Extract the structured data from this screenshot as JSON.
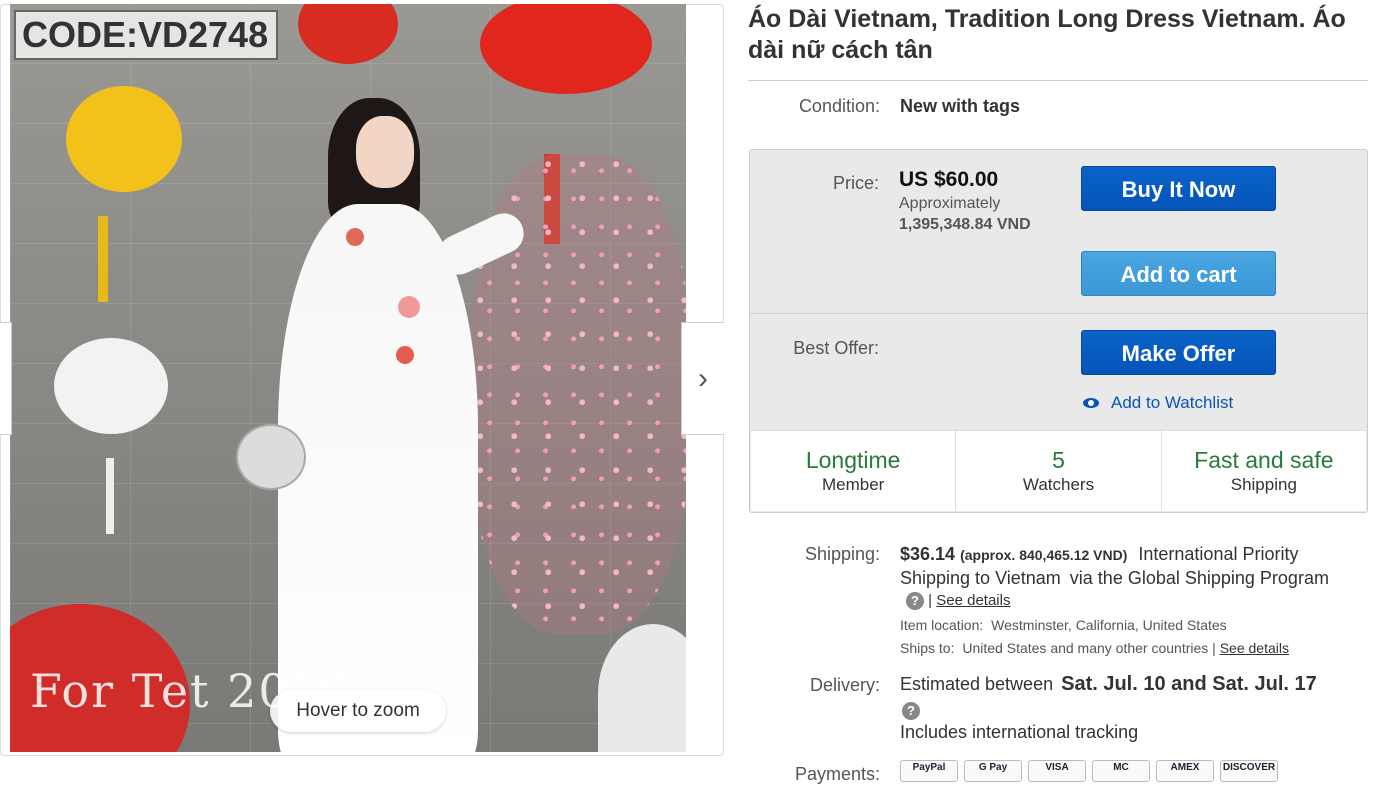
{
  "image": {
    "code_label": "CODE:VD2748",
    "watermark": "For Tet 2019",
    "zoom_hint": "Hover to zoom",
    "next_arrow": "›"
  },
  "listing": {
    "title": "Áo Dài Vietnam, Tradition Long Dress Vietnam. Áo dài nữ cách tân",
    "condition_label": "Condition:",
    "condition_value": "New with tags"
  },
  "buybox": {
    "price_label": "Price:",
    "price_value": "US $60.00",
    "approx_label": "Approximately",
    "approx_value": "1,395,348.84 VND",
    "buy_now": "Buy It Now",
    "add_to_cart": "Add to cart",
    "best_offer_label": "Best Offer:",
    "make_offer": "Make Offer",
    "watchlist": "Add to Watchlist"
  },
  "stats": [
    {
      "top": "Longtime",
      "bottom": "Member"
    },
    {
      "top": "5",
      "bottom": "Watchers"
    },
    {
      "top": "Fast and safe",
      "bottom": "Shipping"
    }
  ],
  "shipping": {
    "label": "Shipping:",
    "cost": "$36.14",
    "approx": "(approx. 840,465.12 VND)",
    "service": "International Priority Shipping to Vietnam",
    "program": "via the Global Shipping Program",
    "see_details": "See details",
    "location_label": "Item location:",
    "location_value": "Westminster, California, United States",
    "ships_to_label": "Ships to:",
    "ships_to_value": "United States and many other countries |",
    "ships_to_link": "See details"
  },
  "delivery": {
    "label": "Delivery:",
    "estimated": "Estimated between",
    "dates": "Sat. Jul. 10 and Sat. Jul. 17",
    "tracking": "Includes international tracking"
  },
  "payments": {
    "label": "Payments:",
    "methods": [
      "PayPal",
      "G Pay",
      "VISA",
      "MC",
      "AMEX",
      "DISCOVER"
    ]
  },
  "colors": {
    "primary_button": "#0654ba",
    "secondary_button": "#3b97d6",
    "stat_green": "#277a3a",
    "link_blue": "#0654ba"
  }
}
